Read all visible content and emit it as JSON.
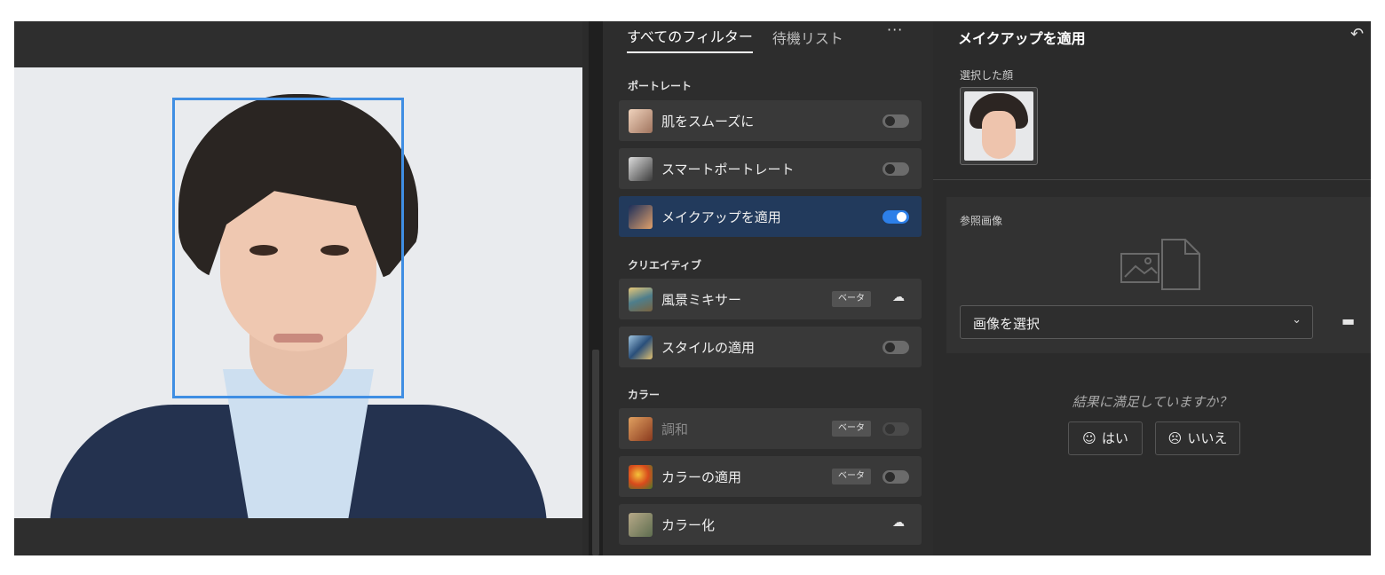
{
  "filters_panel": {
    "tabs": [
      {
        "label": "すべてのフィルター",
        "active": true
      },
      {
        "label": "待機リスト",
        "active": false
      }
    ],
    "more_label": "···",
    "sections": [
      {
        "title": "ポートレート",
        "items": [
          {
            "label": "肌をスムーズに",
            "control": "toggle",
            "state": "off"
          },
          {
            "label": "スマートポートレート",
            "control": "toggle",
            "state": "off"
          },
          {
            "label": "メイクアップを適用",
            "control": "toggle",
            "state": "on",
            "selected": true
          }
        ]
      },
      {
        "title": "クリエイティブ",
        "items": [
          {
            "label": "風景ミキサー",
            "badge": "ベータ",
            "control": "cloud-download"
          },
          {
            "label": "スタイルの適用",
            "control": "toggle",
            "state": "off"
          }
        ]
      },
      {
        "title": "カラー",
        "items": [
          {
            "label": "調和",
            "badge": "ベータ",
            "control": "toggle",
            "state": "disabled"
          },
          {
            "label": "カラーの適用",
            "badge": "ベータ",
            "control": "toggle",
            "state": "off"
          },
          {
            "label": "カラー化",
            "control": "cloud-download"
          }
        ]
      }
    ]
  },
  "settings_panel": {
    "title": "メイクアップを適用",
    "undo_icon": "undo-icon",
    "selected_face_label": "選択した顔",
    "reference_label": "参照画像",
    "select": {
      "value": "画像を選択"
    },
    "folder_icon": "folder-icon",
    "feedback": {
      "question": "結果に満足していますか？",
      "yes_label": "はい",
      "no_label": "いいえ"
    }
  },
  "colors": {
    "accent": "#2d7fe8",
    "face_box": "#3f8ee3",
    "selected_row": "#223a5c"
  }
}
